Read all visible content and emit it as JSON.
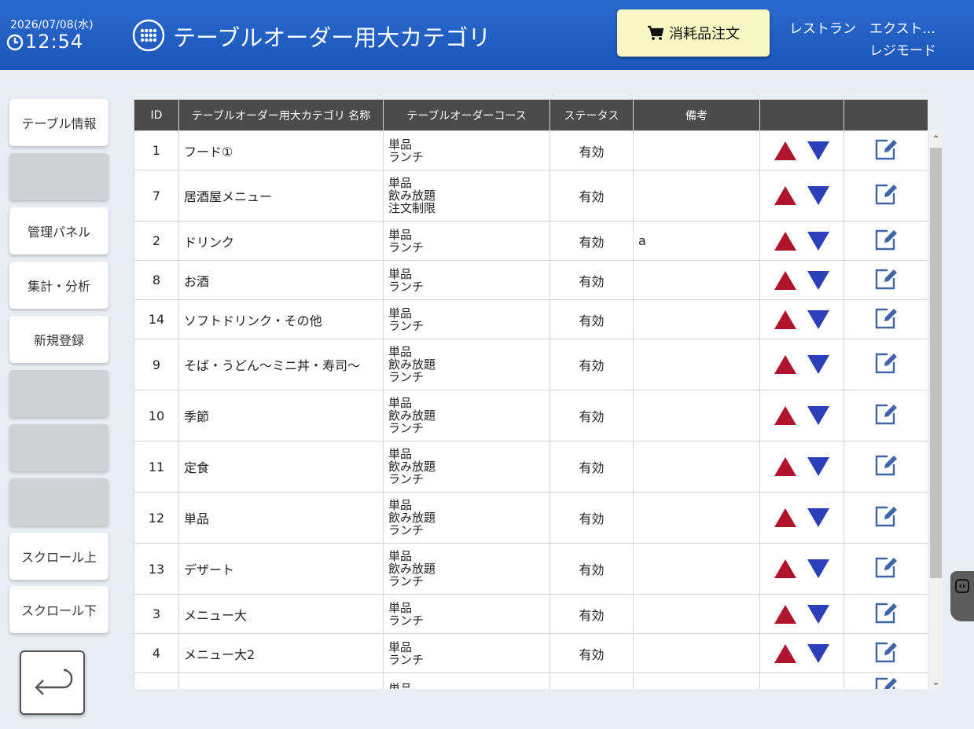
{
  "header": {
    "date": "2026/07/08(水)",
    "time": "12:54",
    "title": "テーブルオーダー用大カテゴリ",
    "order_button": "消耗品注文",
    "store_name": "レストラン　エクスト...",
    "mode": "レジモード"
  },
  "sidebar": {
    "items": [
      {
        "label": "テーブル情報"
      },
      {
        "label": ""
      },
      {
        "label": "管理パネル"
      },
      {
        "label": "集計・分析"
      },
      {
        "label": "新規登録"
      },
      {
        "label": ""
      },
      {
        "label": ""
      },
      {
        "label": ""
      },
      {
        "label": "スクロール上"
      },
      {
        "label": "スクロール下"
      }
    ]
  },
  "table": {
    "headers": [
      "ID",
      "テーブルオーダー用大カテゴリ 名称",
      "テーブルオーダーコース",
      "ステータス",
      "備考",
      "",
      ""
    ],
    "rows": [
      {
        "id": "1",
        "name": "フード①",
        "courses": [
          "単品",
          "ランチ"
        ],
        "status": "有効",
        "remark": ""
      },
      {
        "id": "7",
        "name": "居酒屋メニュー",
        "courses": [
          "単品",
          "飲み放題",
          "注文制限"
        ],
        "status": "有効",
        "remark": ""
      },
      {
        "id": "2",
        "name": "ドリンク",
        "courses": [
          "単品",
          "ランチ"
        ],
        "status": "有効",
        "remark": "a"
      },
      {
        "id": "8",
        "name": "お酒",
        "courses": [
          "単品",
          "ランチ"
        ],
        "status": "有効",
        "remark": ""
      },
      {
        "id": "14",
        "name": "ソフトドリンク・その他",
        "courses": [
          "単品",
          "ランチ"
        ],
        "status": "有効",
        "remark": ""
      },
      {
        "id": "9",
        "name": "そば・うどん～ミニ丼・寿司～",
        "courses": [
          "単品",
          "飲み放題",
          "ランチ"
        ],
        "status": "有効",
        "remark": ""
      },
      {
        "id": "10",
        "name": "季節",
        "courses": [
          "単品",
          "飲み放題",
          "ランチ"
        ],
        "status": "有効",
        "remark": ""
      },
      {
        "id": "11",
        "name": "定食",
        "courses": [
          "単品",
          "飲み放題",
          "ランチ"
        ],
        "status": "有効",
        "remark": ""
      },
      {
        "id": "12",
        "name": "単品",
        "courses": [
          "単品",
          "飲み放題",
          "ランチ"
        ],
        "status": "有効",
        "remark": ""
      },
      {
        "id": "13",
        "name": "デザート",
        "courses": [
          "単品",
          "飲み放題",
          "ランチ"
        ],
        "status": "有効",
        "remark": ""
      },
      {
        "id": "3",
        "name": "メニュー大",
        "courses": [
          "単品",
          "ランチ"
        ],
        "status": "有効",
        "remark": ""
      },
      {
        "id": "4",
        "name": "メニュー大2",
        "courses": [
          "単品",
          "ランチ"
        ],
        "status": "有効",
        "remark": ""
      },
      {
        "id": "",
        "name": "",
        "courses": [
          "単品"
        ],
        "status": "",
        "remark": ""
      }
    ]
  },
  "icons": {
    "clock": "clock-icon",
    "menu": "grid-menu-icon",
    "cart": "cart-icon",
    "up": "move-up-icon",
    "down": "move-down-icon",
    "edit": "edit-icon",
    "back": "back-arrow-icon"
  },
  "colors": {
    "header": "#1f5bbf",
    "up_arrow": "#b0142c",
    "down_arrow": "#2a3fb8",
    "edit_icon": "#3f64a8",
    "order_button": "#fbf7c3",
    "table_header": "#4b4b4b"
  }
}
